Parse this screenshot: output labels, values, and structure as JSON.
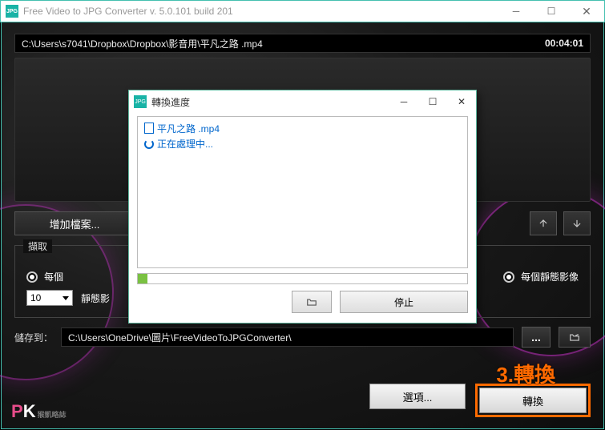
{
  "titlebar": {
    "title": "Free Video to JPG Converter  v. 5.0.101 build 201"
  },
  "file": {
    "path": "C:\\Users\\s7041\\Dropbox\\Dropbox\\影音用\\平凡之路 .mp4",
    "duration": "00:04:01"
  },
  "buttons": {
    "add": "增加檔案...",
    "options": "選項...",
    "convert": "轉換"
  },
  "extract": {
    "legend": "擷取",
    "left_label": "每個",
    "value": "10",
    "unit_partial": "靜態影",
    "right_label": "每個靜態影像"
  },
  "save": {
    "label": "儲存到：",
    "path": "C:\\Users\\OneDrive\\圖片\\FreeVideoToJPGConverter\\"
  },
  "annotation": "3.轉換",
  "pk": {
    "sub": "猴凱略誌"
  },
  "dialog": {
    "title": "轉換進度",
    "file": "平凡之路 .mp4",
    "status": "正在處理中...",
    "stop": "停止"
  }
}
